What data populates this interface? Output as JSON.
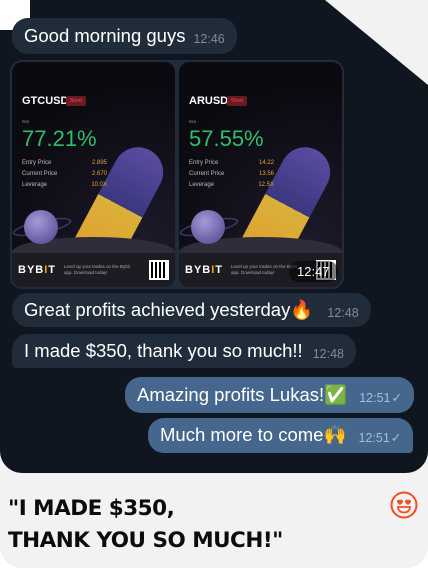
{
  "messages": [
    {
      "text": "Good morning guys",
      "time": "12:46",
      "dir": "in"
    },
    {
      "text": "Great profits achieved yesterday🔥",
      "time": "12:48",
      "dir": "in"
    },
    {
      "text": "I made $350, thank you so much!!",
      "time": "12:48",
      "dir": "in"
    },
    {
      "text": "Amazing profits Lukas!✅",
      "time": "12:51",
      "dir": "out",
      "status": "✓"
    },
    {
      "text": "Much more to come🙌",
      "time": "12:51",
      "dir": "out",
      "status": "✓"
    }
  ],
  "images": {
    "time": "12:47",
    "cards": [
      {
        "symbol": "GTCUSDT",
        "tag": "Short",
        "roi_label": "ROI",
        "roi": "77.21%",
        "rows": [
          [
            "Entry Price",
            "2.895"
          ],
          [
            "Current Price",
            "2.670"
          ],
          [
            "Leverage",
            "10.0X"
          ]
        ],
        "brand": "BYB",
        "brand_accent": "I",
        "brand_end": "T",
        "promo": "Level up your trades on the Bybit app. Download today!"
      },
      {
        "symbol": "ARUSDT",
        "tag": "Short",
        "roi_label": "ROI",
        "roi": "57.55%",
        "rows": [
          [
            "Entry Price",
            "14.22"
          ],
          [
            "Current Price",
            "13.56"
          ],
          [
            "Leverage",
            "12.5X"
          ]
        ],
        "brand": "BYB",
        "brand_accent": "I",
        "brand_end": "T",
        "promo": "Level up your trades on the Bybit app. Download today!"
      }
    ]
  },
  "headline": {
    "line1": "\"I MADE $350,",
    "line2": "THANK YOU SO MUCH!\""
  },
  "colors": {
    "chat_bg": "#0f1620",
    "in_bubble": "#212c3a",
    "out_bubble": "#45678d",
    "accent": "#f04e23",
    "roi": "#2fbf6a"
  },
  "icons": {
    "reaction": "heart-eyes-smiley-icon",
    "read": "check-icon"
  }
}
